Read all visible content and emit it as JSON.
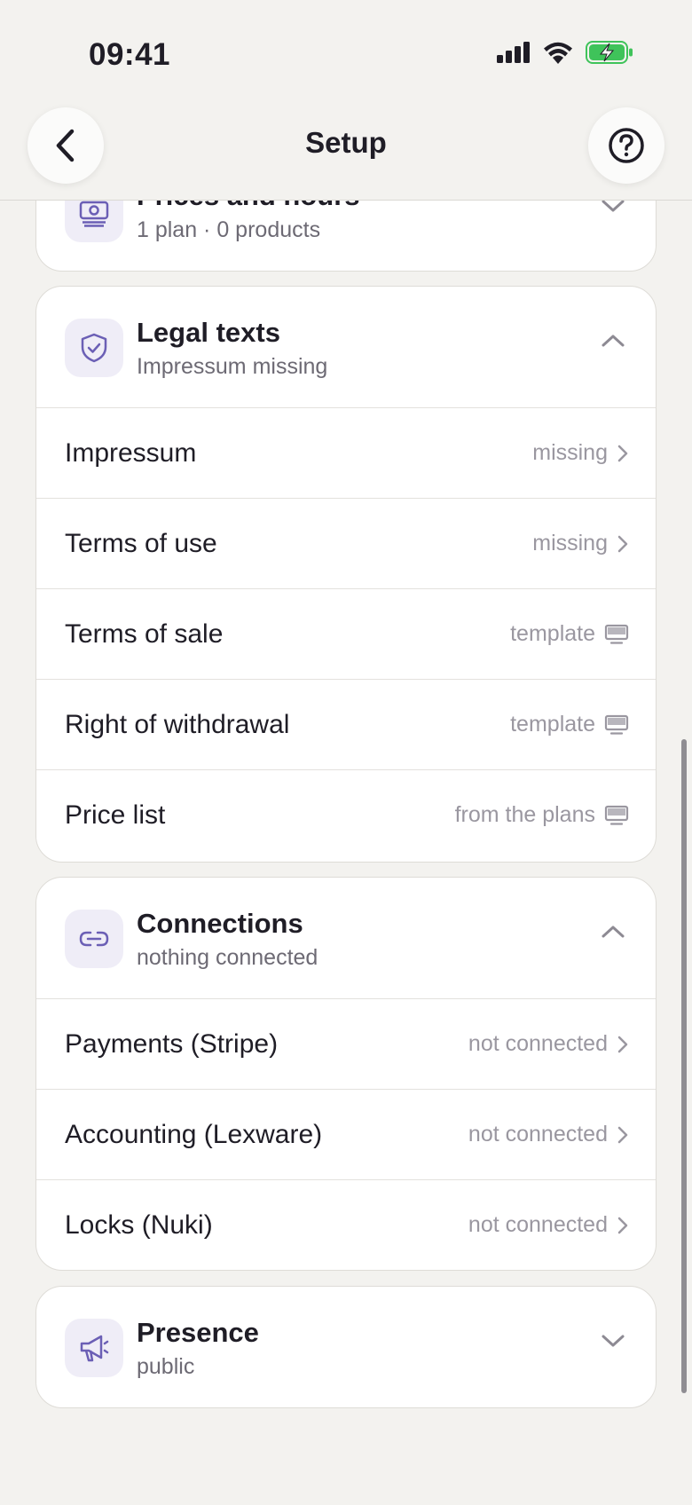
{
  "status_bar": {
    "time": "09:41"
  },
  "header": {
    "title": "Setup"
  },
  "prices_card": {
    "title": "Prices and hours",
    "subtitle": "1 plan · 0 products"
  },
  "legal_card": {
    "title": "Legal texts",
    "subtitle": "Impressum missing",
    "rows": [
      {
        "label": "Impressum",
        "status": "missing",
        "icon": "chevron-right-icon"
      },
      {
        "label": "Terms of use",
        "status": "missing",
        "icon": "chevron-right-icon"
      },
      {
        "label": "Terms of sale",
        "status": "template",
        "icon": "monitor-icon"
      },
      {
        "label": "Right of withdrawal",
        "status": "template",
        "icon": "monitor-icon"
      },
      {
        "label": "Price list",
        "status": "from the plans",
        "icon": "monitor-icon"
      }
    ]
  },
  "connections_card": {
    "title": "Connections",
    "subtitle": "nothing connected",
    "rows": [
      {
        "label": "Payments (Stripe)",
        "status": "not connected",
        "icon": "chevron-right-icon"
      },
      {
        "label": "Accounting (Lexware)",
        "status": "not connected",
        "icon": "chevron-right-icon"
      },
      {
        "label": "Locks (Nuki)",
        "status": "not connected",
        "icon": "chevron-right-icon"
      }
    ]
  },
  "presence_card": {
    "title": "Presence",
    "subtitle": "public"
  },
  "colors": {
    "accent": "#6b5fb5",
    "tile_bg": "#efedf7",
    "background": "#f3f2ef",
    "battery": "#3fc35a"
  }
}
